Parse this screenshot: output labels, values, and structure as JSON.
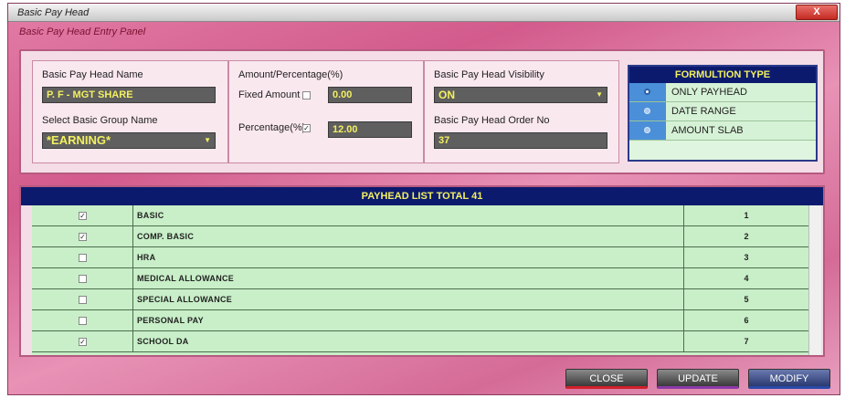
{
  "window": {
    "title": "Basic Pay Head",
    "close_label": "X",
    "panel_title": "Basic Pay Head Entry Panel"
  },
  "entry": {
    "name_label": "Basic Pay Head Name",
    "name_value": "P. F - MGT SHARE",
    "group_label": "Select Basic Group Name",
    "group_value": "*EARNING*",
    "amount_label": "Amount/Percentage(%)",
    "fixed_label": "Fixed Amount",
    "fixed_checked": false,
    "fixed_value": "0.00",
    "percent_label": "Percentage(%)",
    "percent_checked": true,
    "percent_value": "12.00",
    "visibility_label": "Basic Pay Head Visibility",
    "visibility_value": "ON",
    "order_label": "Basic Pay Head Order No",
    "order_value": "37"
  },
  "formula": {
    "title": "FORMULTION TYPE",
    "options": [
      {
        "label": "ONLY PAYHEAD",
        "selected": true
      },
      {
        "label": "DATE RANGE",
        "selected": false
      },
      {
        "label": "AMOUNT SLAB",
        "selected": false
      }
    ]
  },
  "list": {
    "title": "PAYHEAD LIST TOTAL 41",
    "rows": [
      {
        "checked": true,
        "name": "BASIC",
        "order": "1"
      },
      {
        "checked": true,
        "name": "COMP. BASIC",
        "order": "2"
      },
      {
        "checked": false,
        "name": "HRA",
        "order": "3"
      },
      {
        "checked": false,
        "name": "MEDICAL ALLOWANCE",
        "order": "4"
      },
      {
        "checked": false,
        "name": "SPECIAL ALLOWANCE",
        "order": "5"
      },
      {
        "checked": false,
        "name": "PERSONAL PAY",
        "order": "6"
      },
      {
        "checked": true,
        "name": "SCHOOL DA",
        "order": "7"
      }
    ]
  },
  "buttons": {
    "close": "CLOSE",
    "update": "UPDATE",
    "modify": "MODIFY"
  },
  "icons": {
    "check": "✓",
    "dropdown": "▼"
  }
}
